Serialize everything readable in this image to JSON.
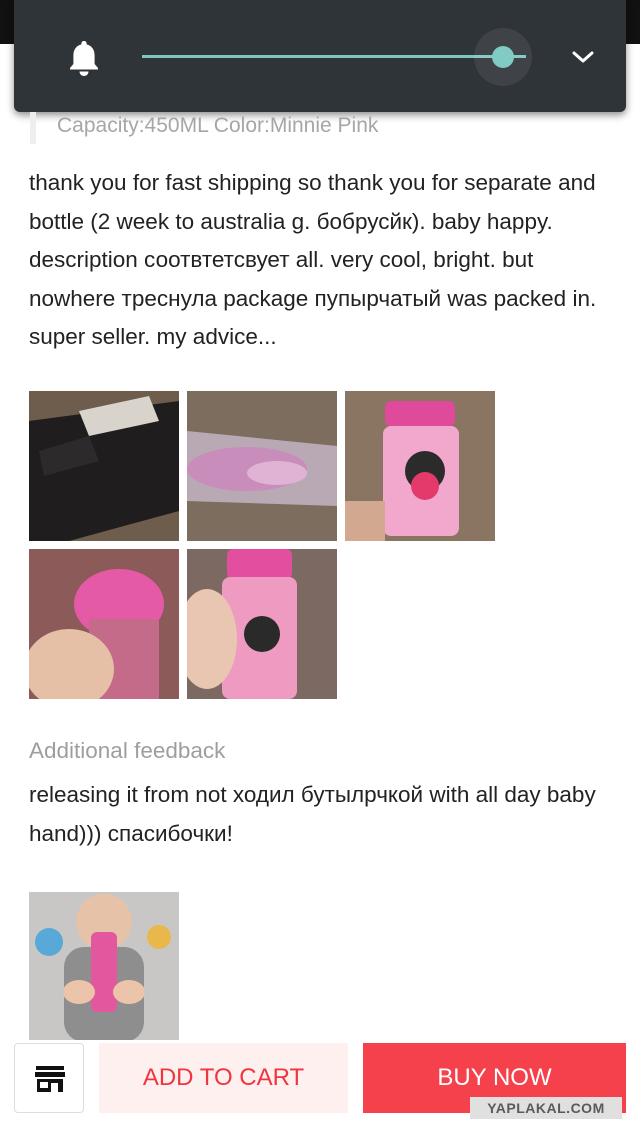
{
  "volume_panel": {
    "level": 0.94,
    "bell_icon": "bell-icon",
    "expand_icon": "chevron-down-icon",
    "accent_color": "#80cbc4"
  },
  "review": {
    "sku": "Capacity:450ML Color:Minnie Pink",
    "text": "thank you for fast shipping so thank you for separate and bottle (2 week to australia g. бобрусйк). baby happy. description соотвтетсвует all. very cool, bright. but nowhere треснула package пупырчатый was packed in. super seller. my advice...",
    "photos": [
      "review-photo-package",
      "review-photo-bubble-wrap",
      "review-photo-bottle",
      "review-photo-bottle-cap",
      "review-photo-bottle-hand"
    ],
    "additional_label": "Additional feedback",
    "additional_text": "releasing it from not ходил бутылрчкой with all day baby hand))) спасибочки!",
    "additional_photos": [
      "review-photo-baby-with-bottle"
    ]
  },
  "actions": {
    "store_icon": "store-icon",
    "add_to_cart": "ADD TO CART",
    "buy_now": "BUY NOW",
    "buy_color": "#f5414c"
  },
  "watermark": "YAPLAKAL.COM"
}
